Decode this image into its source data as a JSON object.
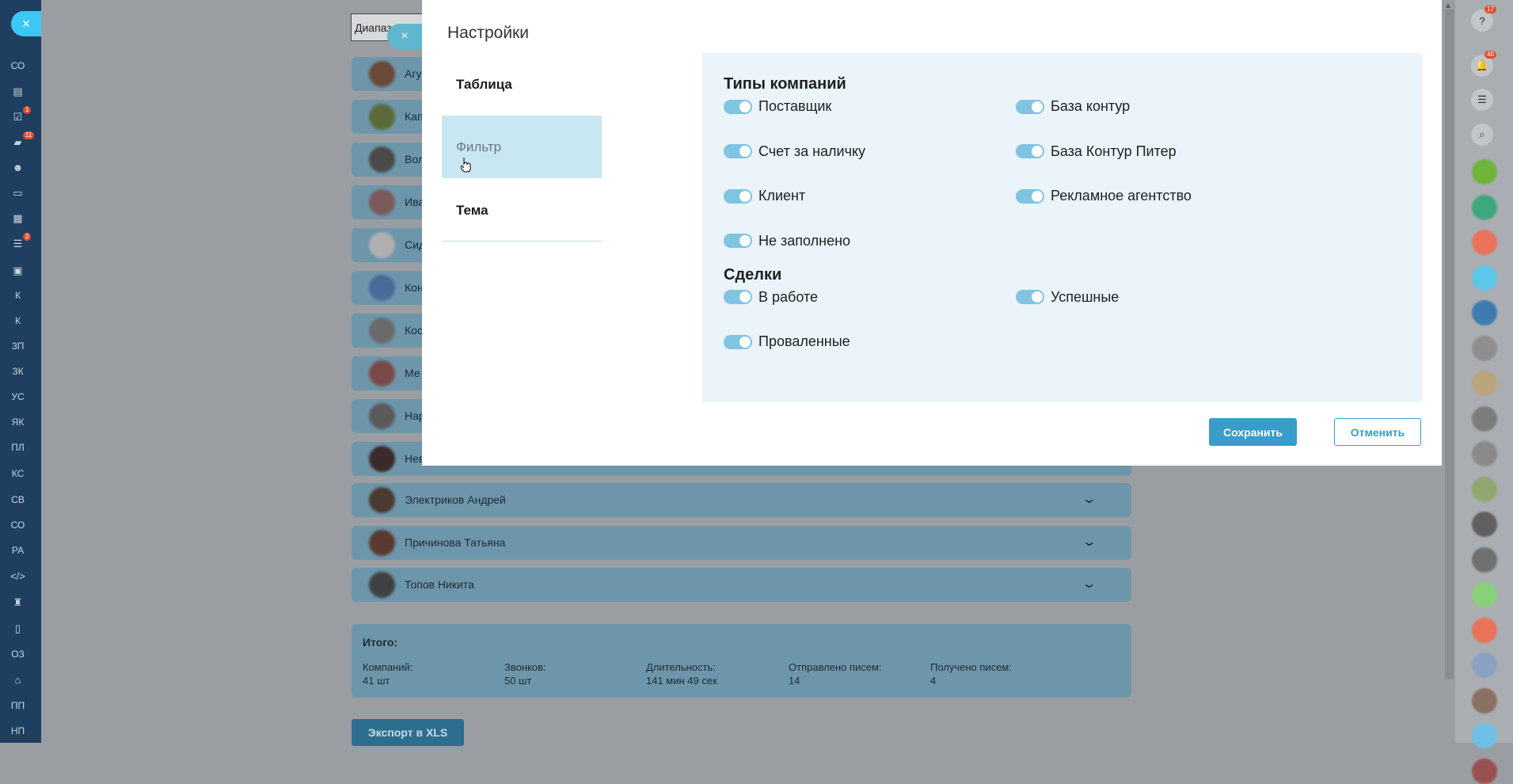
{
  "sidebar": {
    "close_glyph": "×",
    "items": [
      {
        "label": "СО",
        "icon": ""
      },
      {
        "label": "",
        "icon": "newspaper-icon",
        "glyph": "▤"
      },
      {
        "label": "",
        "icon": "tasks-icon",
        "glyph": "☑",
        "badge": "1"
      },
      {
        "label": "",
        "icon": "chat-icon",
        "glyph": "▰",
        "badge": "11"
      },
      {
        "label": "",
        "icon": "users-icon",
        "glyph": "☻"
      },
      {
        "label": "",
        "icon": "inbox-icon",
        "glyph": "▭"
      },
      {
        "label": "",
        "icon": "calendar-icon",
        "glyph": "▦"
      },
      {
        "label": "",
        "icon": "filter-icon",
        "glyph": "☰",
        "badge": "2"
      },
      {
        "label": "",
        "icon": "contact-card-icon",
        "glyph": "▣"
      },
      {
        "label": "К",
        "icon": ""
      },
      {
        "label": "К",
        "icon": ""
      },
      {
        "label": "ЗП",
        "icon": ""
      },
      {
        "label": "ЗК",
        "icon": ""
      },
      {
        "label": "УС",
        "icon": ""
      },
      {
        "label": "ЯК",
        "icon": ""
      },
      {
        "label": "ПЛ",
        "icon": ""
      },
      {
        "label": "КС",
        "icon": ""
      },
      {
        "label": "СВ",
        "icon": ""
      },
      {
        "label": "СО",
        "icon": ""
      },
      {
        "label": "РА",
        "icon": ""
      },
      {
        "label": "",
        "icon": "code-icon",
        "glyph": "</>"
      },
      {
        "label": "",
        "icon": "robot-icon",
        "glyph": "♜"
      },
      {
        "label": "",
        "icon": "document-icon",
        "glyph": "▯"
      },
      {
        "label": "ОЗ",
        "icon": ""
      },
      {
        "label": "",
        "icon": "bank-icon",
        "glyph": "⌂"
      },
      {
        "label": "ПП",
        "icon": ""
      },
      {
        "label": "НП",
        "icon": ""
      }
    ]
  },
  "background": {
    "date_range_text": "Диапаз",
    "rows": [
      {
        "name": "Агу"
      },
      {
        "name": "Кап"
      },
      {
        "name": "Вол"
      },
      {
        "name": "Ива"
      },
      {
        "name": "Сид"
      },
      {
        "name": "Кон"
      },
      {
        "name": "Кос"
      },
      {
        "name": "Ме"
      },
      {
        "name": "Нар"
      },
      {
        "name": "Нев"
      },
      {
        "name": "Электриков Андрей"
      },
      {
        "name": "Причинова Татьяна"
      },
      {
        "name": "Топов Никита"
      }
    ],
    "chevron": "⌄",
    "total": {
      "title": "Итого:",
      "columns": [
        {
          "label": "Компаний:",
          "value": "41 шт"
        },
        {
          "label": "Звонков:",
          "value": "50 шт"
        },
        {
          "label": "Длительность:",
          "value": "141 мин 49 сек"
        },
        {
          "label": "Отправлено писем:",
          "value": "14"
        },
        {
          "label": "Получено писем:",
          "value": "4"
        }
      ]
    },
    "export_label": "Экспорт в XLS"
  },
  "right_panel": {
    "icons": [
      {
        "name": "help-icon",
        "glyph": "?",
        "badge": "17"
      },
      {
        "name": "bell-icon",
        "glyph": "🔔",
        "badge": "40"
      },
      {
        "name": "chat-bubble-icon",
        "glyph": "☰",
        "badge": ""
      },
      {
        "name": "search-icon",
        "glyph": "⌕",
        "badge": ""
      }
    ],
    "avatar_colors": [
      "#6fb33b",
      "#3fa77d",
      "#e8735a",
      "#5cc7e8",
      "#3f7bb0",
      "#8e8e8e",
      "#b9a47c",
      "#7c7c7c",
      "#8a8a8a",
      "#8fa870",
      "#606060",
      "#707070",
      "#88d07a",
      "#e8735a",
      "#8aa0c4",
      "#8a7060",
      "#6ec0e8",
      "#9a5050"
    ]
  },
  "modal": {
    "close_glyph": "×",
    "title": "Настройки",
    "tabs": [
      {
        "label": "Таблица",
        "active": false
      },
      {
        "label": "Фильтр",
        "active": true
      },
      {
        "label": "Тема",
        "active": false
      }
    ],
    "sections": [
      {
        "title": "Типы компаний",
        "toggles": [
          {
            "label": "Поставщик",
            "on": true
          },
          {
            "label": "База контур",
            "on": true
          },
          {
            "label": "Счет за наличку",
            "on": true
          },
          {
            "label": "База Контур Питер",
            "on": true
          },
          {
            "label": "Клиент",
            "on": true
          },
          {
            "label": "Рекламное агентство",
            "on": true
          },
          {
            "label": "Не заполнено",
            "on": true
          }
        ]
      },
      {
        "title": "Сделки",
        "toggles": [
          {
            "label": "В работе",
            "on": true
          },
          {
            "label": "Успешные",
            "on": true
          },
          {
            "label": "Проваленные",
            "on": true
          }
        ]
      }
    ],
    "save_label": "Сохранить",
    "cancel_label": "Отменить"
  }
}
